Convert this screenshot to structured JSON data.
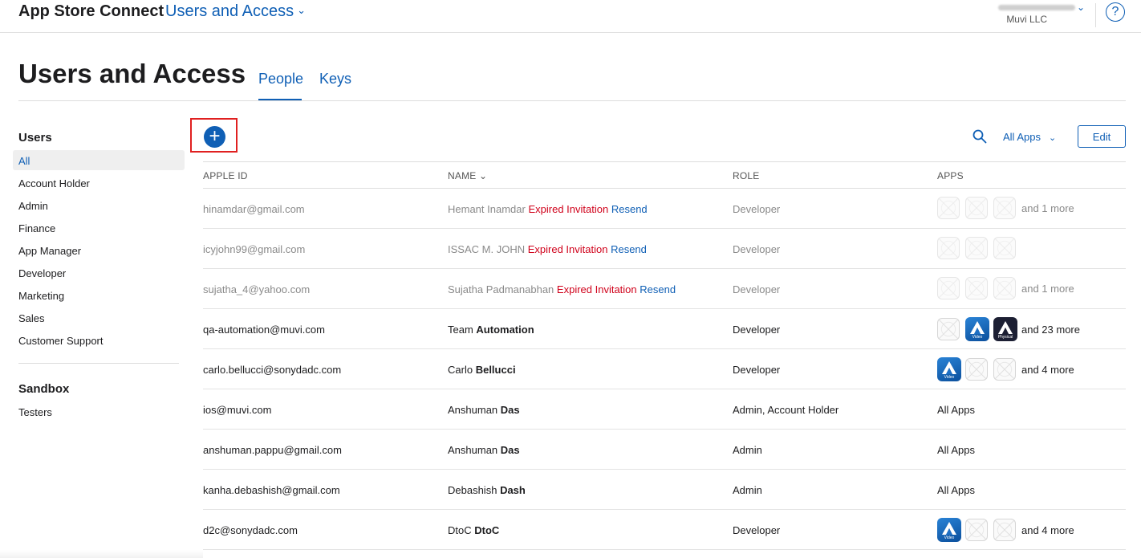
{
  "topbar": {
    "brand": "App Store Connect",
    "section": "Users and Access",
    "org": "Muvi LLC",
    "help": "?"
  },
  "header": {
    "title": "Users and Access",
    "tabs": [
      {
        "label": "People",
        "active": true
      },
      {
        "label": "Keys",
        "active": false
      }
    ]
  },
  "sidebar": {
    "users_heading": "Users",
    "items": [
      "All",
      "Account Holder",
      "Admin",
      "Finance",
      "App Manager",
      "Developer",
      "Marketing",
      "Sales",
      "Customer Support"
    ],
    "selected": "All",
    "sandbox_heading": "Sandbox",
    "sandbox_items": [
      "Testers"
    ]
  },
  "toolbar": {
    "add_icon": "plus-circle-icon",
    "search_icon": "search-icon",
    "filter_label": "All Apps",
    "edit_label": "Edit"
  },
  "table": {
    "columns": [
      "APPLE ID",
      "NAME",
      "ROLE",
      "APPS"
    ],
    "sort_indicator": "⌄",
    "rows": [
      {
        "apple_id": "hinamdar@gmail.com",
        "first": "Hemant",
        "last": "Inamdar",
        "status": "Expired Invitation",
        "action": "Resend",
        "role": "Developer",
        "apps": [
          "ph",
          "ph",
          "ph"
        ],
        "more": "and 1 more",
        "pending": true
      },
      {
        "apple_id": "icyjohn99@gmail.com",
        "first": "ISSAC M.",
        "last": "JOHN",
        "status": "Expired Invitation",
        "action": "Resend",
        "role": "Developer",
        "apps": [
          "ph",
          "ph",
          "ph"
        ],
        "more": "",
        "pending": true
      },
      {
        "apple_id": "sujatha_4@yahoo.com",
        "first": "Sujatha",
        "last": "Padmanabhan",
        "status": "Expired Invitation",
        "action": "Resend",
        "role": "Developer",
        "apps": [
          "ph",
          "ph",
          "ph"
        ],
        "more": "and 1 more",
        "pending": true
      },
      {
        "apple_id": "qa-automation@muvi.com",
        "first": "Team",
        "last": "Automation",
        "status": "",
        "action": "",
        "role": "Developer",
        "apps": [
          "ph",
          "video",
          "physical"
        ],
        "more": "and 23 more",
        "pending": false
      },
      {
        "apple_id": "carlo.bellucci@sonydadc.com",
        "first": "Carlo",
        "last": "Bellucci",
        "status": "",
        "action": "",
        "role": "Developer",
        "apps": [
          "video",
          "ph",
          "ph"
        ],
        "more": "and 4 more",
        "pending": false
      },
      {
        "apple_id": "ios@muvi.com",
        "first": "Anshuman",
        "last": "Das",
        "status": "",
        "action": "",
        "role": "Admin, Account Holder",
        "apps": [],
        "apps_text": "All Apps",
        "more": "",
        "pending": false
      },
      {
        "apple_id": "anshuman.pappu@gmail.com",
        "first": "Anshuman",
        "last": "Das",
        "status": "",
        "action": "",
        "role": "Admin",
        "apps": [],
        "apps_text": "All Apps",
        "more": "",
        "pending": false
      },
      {
        "apple_id": "kanha.debashish@gmail.com",
        "first": "Debashish",
        "last": "Dash",
        "status": "",
        "action": "",
        "role": "Admin",
        "apps": [],
        "apps_text": "All Apps",
        "more": "",
        "pending": false
      },
      {
        "apple_id": "d2c@sonydadc.com",
        "first": "DtoC",
        "last": "DtoC",
        "status": "",
        "action": "",
        "role": "Developer",
        "apps": [
          "video",
          "ph",
          "ph"
        ],
        "more": "and 4 more",
        "pending": false
      }
    ],
    "app_tags": {
      "video": "Video",
      "physical": "Physical"
    }
  },
  "colors": {
    "accent": "#0f5fb5",
    "error": "#d0021b",
    "highlight_box": "#e02020"
  }
}
